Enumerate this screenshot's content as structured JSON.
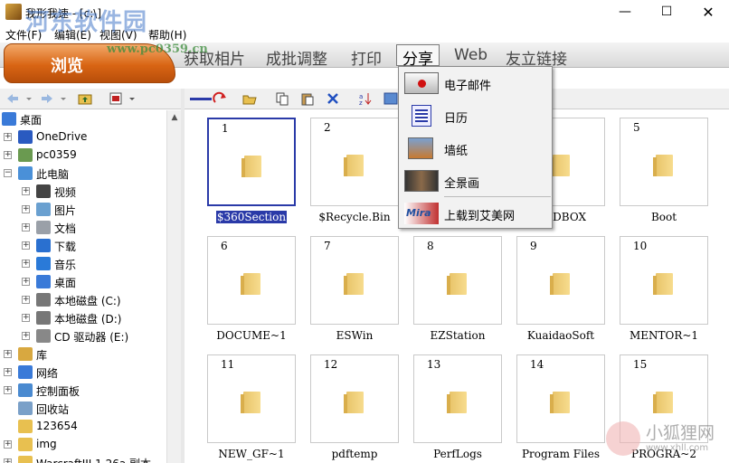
{
  "window": {
    "title": "我形我速 - [c:\\]",
    "min_symbol": "—",
    "max_symbol": "☐",
    "close_symbol": "✕"
  },
  "watermark": {
    "site_name": "河东软件园",
    "site_url": "www.pc0359.cn",
    "corner_name": "小狐狸网",
    "corner_url": "www.xhll.com"
  },
  "menu": {
    "items": [
      "文件(F)",
      "编辑(E)",
      "视图(V)",
      "帮助(H)"
    ]
  },
  "tabs": {
    "active": "浏览",
    "items": [
      "获取相片",
      "成批调整",
      "打印",
      "分享",
      "Web",
      "友立链接"
    ]
  },
  "share_menu": {
    "items": [
      {
        "label": "电子邮件",
        "icon": "email-icon"
      },
      {
        "label": "日历",
        "icon": "calendar-icon"
      },
      {
        "label": "墙纸",
        "icon": "wallpaper-icon"
      },
      {
        "label": "全景画",
        "icon": "panorama-icon"
      },
      {
        "label": "上载到艾美网",
        "icon": "imira-upload-icon"
      }
    ]
  },
  "tree": {
    "items": [
      {
        "label": "桌面",
        "icon": "desktop-icon",
        "depth": 0,
        "exp": ""
      },
      {
        "label": "OneDrive",
        "icon": "cloud-icon",
        "depth": 1,
        "exp": "+"
      },
      {
        "label": "pc0359",
        "icon": "user-icon",
        "depth": 1,
        "exp": "+"
      },
      {
        "label": "此电脑",
        "icon": "computer-icon",
        "depth": 1,
        "exp": "−"
      },
      {
        "label": "视频",
        "icon": "video-icon",
        "depth": 2,
        "exp": "+"
      },
      {
        "label": "图片",
        "icon": "picture-icon",
        "depth": 2,
        "exp": "+"
      },
      {
        "label": "文档",
        "icon": "document-icon",
        "depth": 2,
        "exp": "+"
      },
      {
        "label": "下载",
        "icon": "download-icon",
        "depth": 2,
        "exp": "+"
      },
      {
        "label": "音乐",
        "icon": "music-icon",
        "depth": 2,
        "exp": "+"
      },
      {
        "label": "桌面",
        "icon": "desktop-icon",
        "depth": 2,
        "exp": "+"
      },
      {
        "label": "本地磁盘 (C:)",
        "icon": "drive-icon",
        "depth": 2,
        "exp": "+"
      },
      {
        "label": "本地磁盘 (D:)",
        "icon": "drive-icon",
        "depth": 2,
        "exp": "+"
      },
      {
        "label": "CD 驱动器 (E:)",
        "icon": "cd-drive-icon",
        "depth": 2,
        "exp": "+"
      },
      {
        "label": "库",
        "icon": "library-icon",
        "depth": 1,
        "exp": "+"
      },
      {
        "label": "网络",
        "icon": "network-icon",
        "depth": 1,
        "exp": "+"
      },
      {
        "label": "控制面板",
        "icon": "control-panel-icon",
        "depth": 1,
        "exp": "+"
      },
      {
        "label": "回收站",
        "icon": "recycle-bin-icon",
        "depth": 1,
        "exp": ""
      },
      {
        "label": "123654",
        "icon": "folder-icon",
        "depth": 1,
        "exp": ""
      },
      {
        "label": "img",
        "icon": "folder-icon",
        "depth": 1,
        "exp": "+"
      },
      {
        "label": "WarcraftIII 1.26a 副本",
        "icon": "folder-icon",
        "depth": 1,
        "exp": "+"
      }
    ]
  },
  "thumbnails": {
    "items": [
      {
        "num": "1",
        "name": "$360Section",
        "selected": true
      },
      {
        "num": "2",
        "name": "$Recycle.Bin"
      },
      {
        "num": "",
        "name": ""
      },
      {
        "num": "",
        "name": "ANDBOX"
      },
      {
        "num": "5",
        "name": "Boot"
      },
      {
        "num": "6",
        "name": "DOCUME~1"
      },
      {
        "num": "7",
        "name": "ESWin"
      },
      {
        "num": "8",
        "name": "EZStation"
      },
      {
        "num": "9",
        "name": "KuaidaoSoft"
      },
      {
        "num": "10",
        "name": "MENTOR~1"
      },
      {
        "num": "11",
        "name": "NEW_GF~1"
      },
      {
        "num": "12",
        "name": "pdftemp"
      },
      {
        "num": "13",
        "name": "PerfLogs"
      },
      {
        "num": "14",
        "name": "Program Files"
      },
      {
        "num": "15",
        "name": "PROGRA~2"
      }
    ]
  }
}
